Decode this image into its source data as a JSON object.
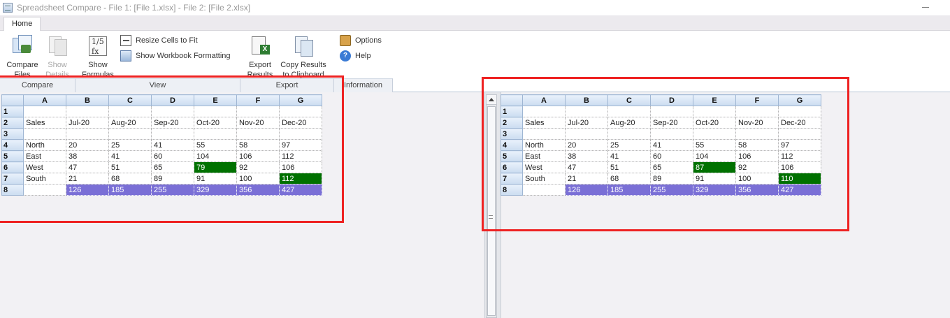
{
  "window": {
    "title": "Spreadsheet Compare - File 1: [File 1.xlsx] - File 2: [File 2.xlsx]"
  },
  "ribbon": {
    "tab_home": "Home",
    "compare_files": [
      "Compare",
      "Files"
    ],
    "show_details": [
      "Show",
      "Details"
    ],
    "show_formulas": [
      "Show",
      "Formulas"
    ],
    "resize_cells": "Resize Cells to Fit",
    "show_formatting": "Show Workbook Formatting",
    "export_results": [
      "Export",
      "Results"
    ],
    "copy_results": [
      "Copy Results",
      "to Clipboard"
    ],
    "options": "Options",
    "help": "Help",
    "groups": {
      "compare": "Compare",
      "view": "View",
      "export": "Export",
      "information": "Information"
    }
  },
  "left_sheet": {
    "columns": [
      "A",
      "B",
      "C",
      "D",
      "E",
      "F",
      "G"
    ],
    "rows": [
      [
        "",
        "",
        "",
        "",
        "",
        "",
        ""
      ],
      [
        "Sales",
        "Jul-20",
        "Aug-20",
        "Sep-20",
        "Oct-20",
        "Nov-20",
        "Dec-20"
      ],
      [
        "",
        "",
        "",
        "",
        "",
        "",
        ""
      ],
      [
        "North",
        "20",
        "25",
        "41",
        "55",
        "58",
        "97"
      ],
      [
        "East",
        "38",
        "41",
        "60",
        "104",
        "106",
        "112"
      ],
      [
        "West",
        "47",
        "51",
        "65",
        "79",
        "92",
        "106"
      ],
      [
        "South",
        "21",
        "68",
        "89",
        "91",
        "100",
        "112"
      ],
      [
        "",
        "126",
        "185",
        "255",
        "329",
        "356",
        "427"
      ]
    ]
  },
  "right_sheet": {
    "columns": [
      "A",
      "B",
      "C",
      "D",
      "E",
      "F",
      "G"
    ],
    "rows": [
      [
        "",
        "",
        "",
        "",
        "",
        "",
        ""
      ],
      [
        "Sales",
        "Jul-20",
        "Aug-20",
        "Sep-20",
        "Oct-20",
        "Nov-20",
        "Dec-20"
      ],
      [
        "",
        "",
        "",
        "",
        "",
        "",
        ""
      ],
      [
        "North",
        "20",
        "25",
        "41",
        "55",
        "58",
        "97"
      ],
      [
        "East",
        "38",
        "41",
        "60",
        "104",
        "106",
        "112"
      ],
      [
        "West",
        "47",
        "51",
        "65",
        "87",
        "92",
        "106"
      ],
      [
        "South",
        "21",
        "68",
        "89",
        "91",
        "100",
        "110"
      ],
      [
        "",
        "126",
        "185",
        "255",
        "329",
        "356",
        "427"
      ]
    ]
  },
  "colors": {
    "diff_cell": "#007100",
    "total_row": "#7a6fd6",
    "highlight_box": "#ee2222"
  }
}
